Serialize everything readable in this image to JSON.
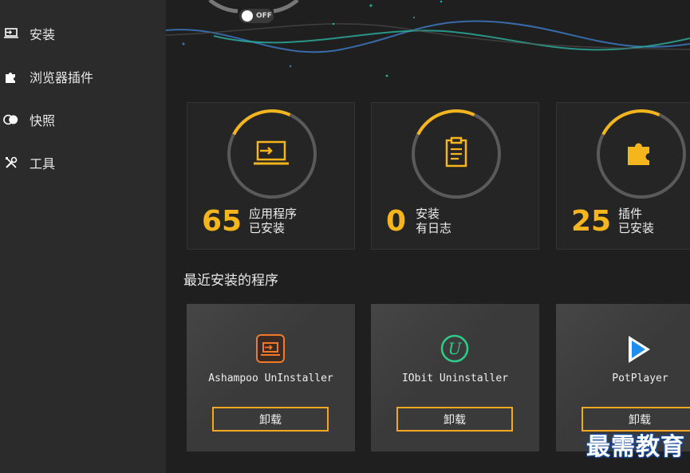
{
  "sidebar": {
    "items": [
      {
        "label": "安装",
        "icon": "install-icon"
      },
      {
        "label": "浏览器插件",
        "icon": "puzzle-icon"
      },
      {
        "label": "快照",
        "icon": "snapshot-icon"
      },
      {
        "label": "工具",
        "icon": "tools-icon"
      }
    ]
  },
  "header": {
    "toggle_label": "OFF"
  },
  "stats": [
    {
      "value": "65",
      "line1": "应用程序",
      "line2": "已安装",
      "icon": "install-icon"
    },
    {
      "value": "0",
      "line1": "安装",
      "line2": "有日志",
      "icon": "clipboard-icon"
    },
    {
      "value": "25",
      "line1": "插件",
      "line2": "已安装",
      "icon": "puzzle-icon"
    }
  ],
  "recent": {
    "title": "最近安装的程序",
    "items": [
      {
        "name": "Ashampoo UnInstaller",
        "button": "卸载",
        "icon": "ashampoo-icon"
      },
      {
        "name": "IObit Uninstaller",
        "button": "卸载",
        "icon": "iobit-icon"
      },
      {
        "name": "PotPlayer",
        "button": "卸载",
        "icon": "potplayer-icon"
      }
    ]
  },
  "watermark": "最需教育",
  "colors": {
    "accent": "#f5b51c",
    "button_border": "#f5a623",
    "ring_track": "#5a5a5a"
  }
}
